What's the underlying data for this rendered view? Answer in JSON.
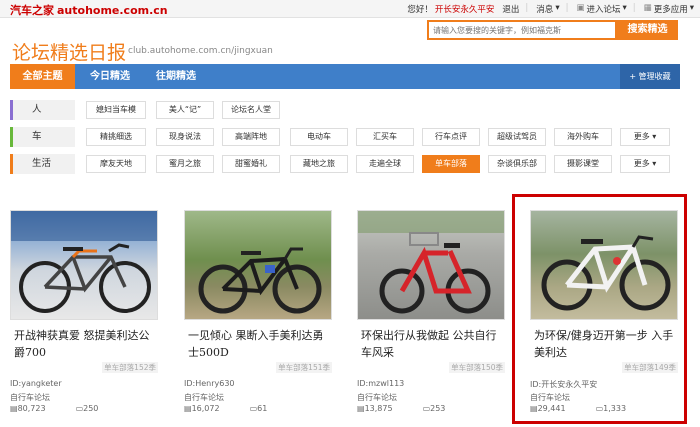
{
  "topbar": {
    "logo": "汽车之家",
    "domain": "autohome.com.cn",
    "greeting": "您好！",
    "user": "开长安永久平安",
    "logout": "退出",
    "messages": "消息",
    "enter_forum": "进入论坛",
    "more_apps": "更多应用"
  },
  "header": {
    "title": "论坛精选日报",
    "url": "club.autohome.com.cn/jingxuan",
    "search_placeholder": "请输入您要搜的关键字，例如福克斯",
    "search_button": "搜索精选"
  },
  "nav": {
    "tabs": [
      {
        "label": "全部主题"
      },
      {
        "label": "今日精选"
      },
      {
        "label": "往期精选"
      }
    ],
    "manage": "管理收藏"
  },
  "categories": [
    {
      "label": "人",
      "color": "#8a6fd1",
      "tags": [
        "媳妇当车模",
        "美人“记”",
        "论坛名人堂"
      ]
    },
    {
      "label": "车",
      "color": "#68b83b",
      "tags": [
        "精挑细选",
        "现身说法",
        "高端阵地",
        "电动车",
        "汇买车",
        "行车点评",
        "超级试驾员",
        "海外购车",
        "更多"
      ]
    },
    {
      "label": "生活",
      "color": "#f07d1b",
      "tags": [
        "摩友天地",
        "蜜月之旅",
        "甜蜜婚礼",
        "藏地之旅",
        "走遍全球",
        "单车部落",
        "杂谈俱乐部",
        "摄影课堂",
        "更多"
      ]
    }
  ],
  "cards": [
    {
      "title": "开战神获真爱 怒提美利达公爵700",
      "source": "单车部落152季",
      "uid": "ID:yangketer",
      "forum": "自行车论坛",
      "views": "80,723",
      "replies": "250"
    },
    {
      "title": "一见倾心 果断入手美利达勇士500D",
      "source": "单车部落151季",
      "uid": "ID:Henry630",
      "forum": "自行车论坛",
      "views": "16,072",
      "replies": "61"
    },
    {
      "title": "环保出行从我做起 公共自行车风采",
      "source": "单车部落150季",
      "uid": "ID:mzwl113",
      "forum": "自行车论坛",
      "views": "13,875",
      "replies": "253"
    },
    {
      "title": "为环保/健身迈开第一步 入手美利达",
      "source": "单车部落149季",
      "uid": "ID:开长安永久平安",
      "forum": "自行车论坛",
      "views": "29,441",
      "replies": "1,333"
    }
  ],
  "colors": {
    "orange": "#f07d1b",
    "blue": "#3f7fc9",
    "red": "#c00"
  }
}
